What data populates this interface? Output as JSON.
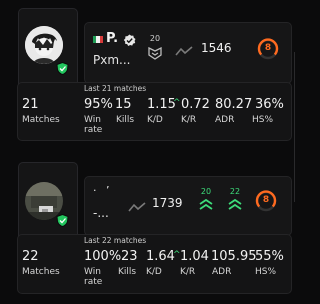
{
  "player1": {
    "name": "P.",
    "nickname": "Pxm...",
    "rank_number": "20",
    "elo": "1546",
    "level": "8",
    "last_matches_label": "Last 21 matches",
    "matches_value": "21",
    "matches_label": "Matches",
    "stats": [
      {
        "value": "95%",
        "label": "Win rate"
      },
      {
        "value": "15",
        "label": "Kills"
      },
      {
        "value": "1.15",
        "label": "K/D"
      },
      {
        "value": "0.72",
        "label": "K/R"
      },
      {
        "value": "80.27",
        "label": "ADR"
      },
      {
        "value": "36%",
        "label": "HS%"
      }
    ],
    "stats_labels": {
      "win_line1": "Win",
      "win_line2": "rate"
    }
  },
  "player2": {
    "name": "· ’",
    "nickname": "-...",
    "elo": "1739",
    "rank_left": "20",
    "rank_right": "22",
    "level": "8",
    "last_matches_label": "Last 22 matches",
    "matches_value": "22",
    "matches_label": "Matches",
    "stats": [
      {
        "value": "100%",
        "label": "Win rate"
      },
      {
        "value": "23",
        "label": "Kills"
      },
      {
        "value": "1.64",
        "label": "K/D"
      },
      {
        "value": "1.04",
        "label": "K/R"
      },
      {
        "value": "105.95",
        "label": "ADR"
      },
      {
        "value": "55%",
        "label": "HS%"
      }
    ],
    "stats_labels": {
      "win_line1": "Win",
      "win_line2": "rate"
    }
  },
  "colors": {
    "accent_orange": "#ff6a1f",
    "accent_green": "#3ddc7a",
    "verified_green": "#22c55e"
  }
}
